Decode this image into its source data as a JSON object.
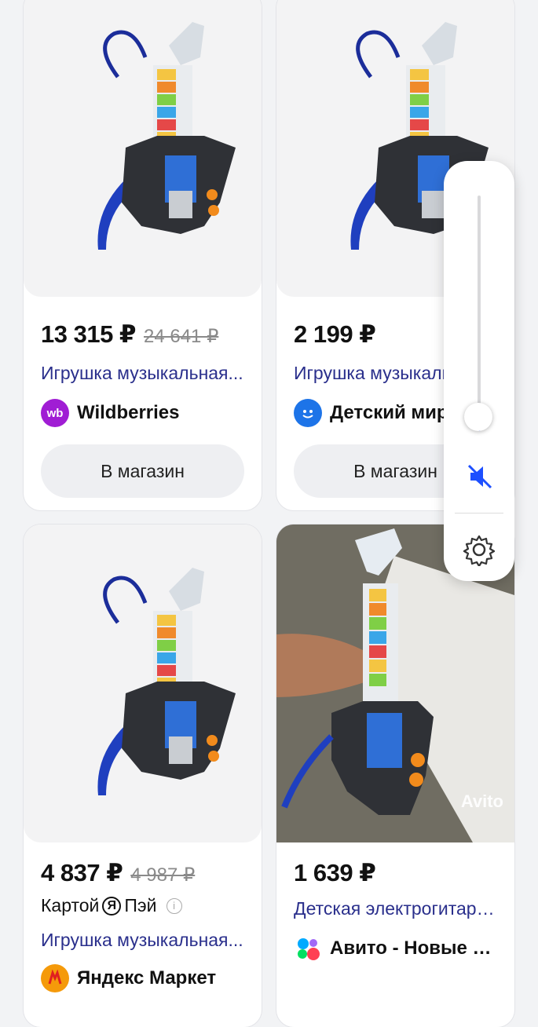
{
  "cards": [
    {
      "price": "13 315 ₽",
      "old_price": "24 641 ₽",
      "title": "Игрушка музыкальная...",
      "merchant": "Wildberries",
      "merchant_logo_text": "wb",
      "merchant_logo_color": "#a01dd4",
      "button": "В магазин"
    },
    {
      "price": "2 199 ₽",
      "old_price": "",
      "title": "Игрушка музыкальная...",
      "merchant": "Детский мир",
      "merchant_logo_color": "#1d74e8",
      "button": "В магазин"
    },
    {
      "price": "4 837 ₽",
      "old_price": "4 987 ₽",
      "pay_left": "Картой",
      "pay_mark": "Я",
      "pay_right": "Пэй",
      "title": "Игрушка музыкальная...",
      "merchant": "Яндекс Маркет",
      "merchant_logo_color": "#f59a0a"
    },
    {
      "price": "1 639 ₽",
      "title": "Детская электрогитара...",
      "merchant": "Авито - Новые и б/у",
      "image_watermark": "Avito"
    }
  ],
  "controls": {
    "volume_level": 0.05,
    "mute_icon": "speaker-muted-icon",
    "settings_icon": "gear-icon"
  },
  "colors": {
    "title_link": "#2a2f8c",
    "accent_blue": "#1d4fff",
    "button_bg": "#eeeff2"
  }
}
